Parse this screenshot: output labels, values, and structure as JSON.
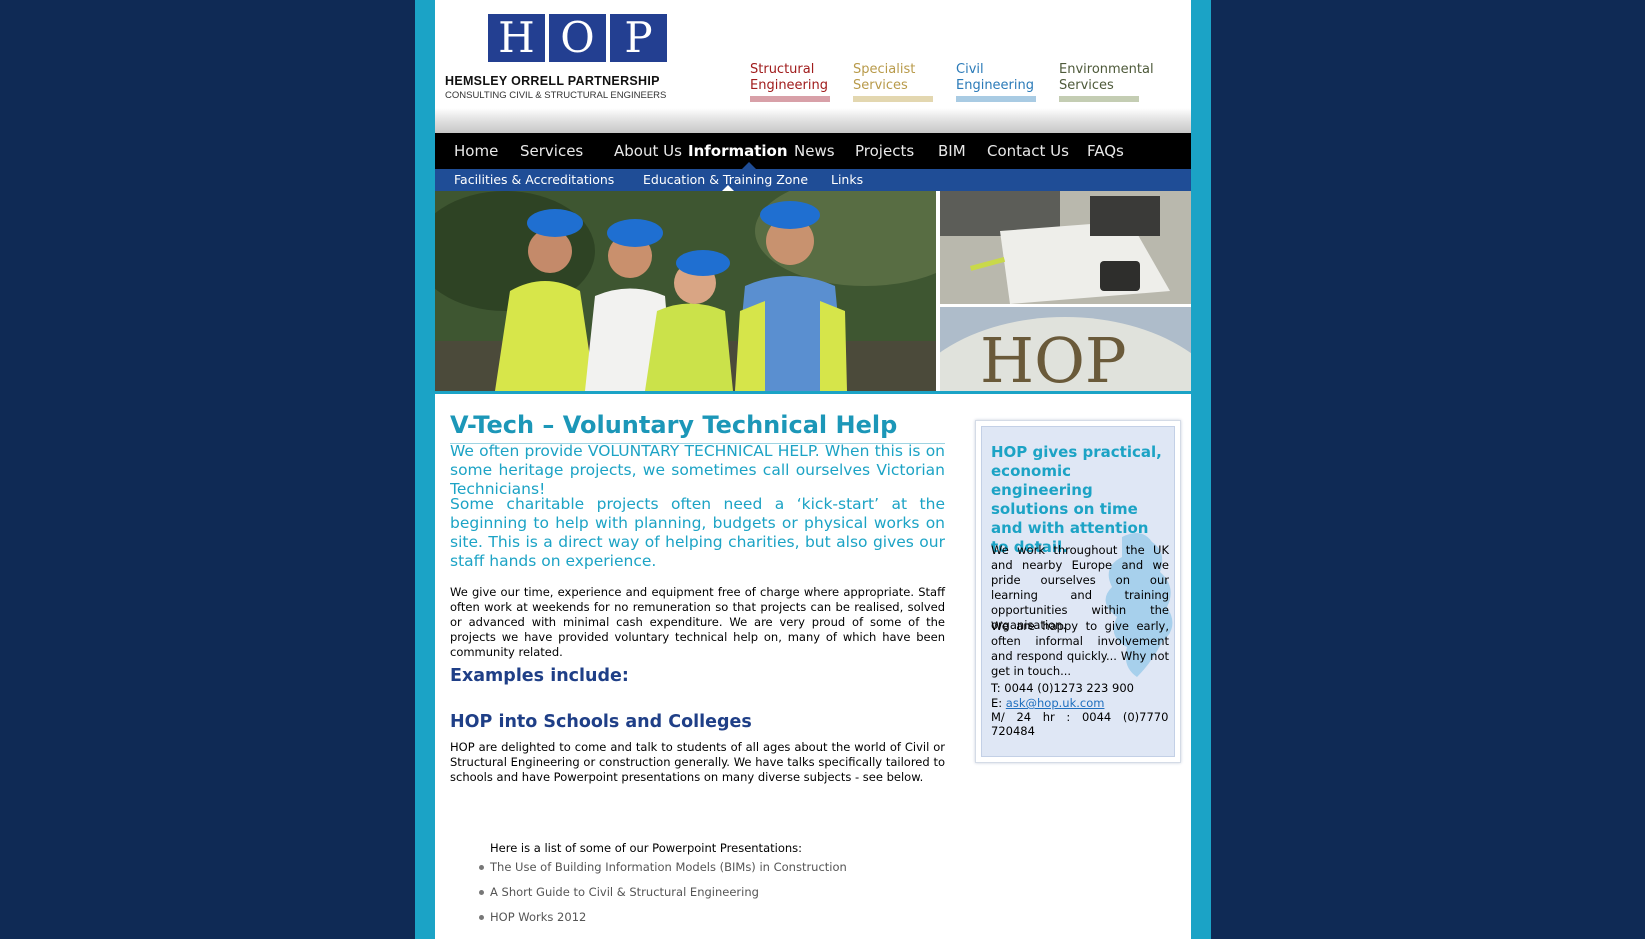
{
  "header": {
    "logo_letters": [
      "H",
      "O",
      "P"
    ],
    "company_name": "HEMSLEY ORRELL PARTNERSHIP",
    "tagline": "CONSULTING CIVIL & STRUCTURAL ENGINEERS",
    "service_links": [
      {
        "line1": "Structural",
        "line2": "Engineering",
        "color": "#a01c1c",
        "bar_color": "#d8a0a8"
      },
      {
        "line1": "Specialist",
        "line2": "Services",
        "color": "#b89a4a",
        "bar_color": "#e3d7b0"
      },
      {
        "line1": "Civil",
        "line2": "Engineering",
        "color": "#2a7ab8",
        "bar_color": "#a9cbe3"
      },
      {
        "line1": "Environmental",
        "line2": "Services",
        "color": "#4e5a3a",
        "bar_color": "#c4cdb3"
      }
    ]
  },
  "nav": {
    "items": [
      "Home",
      "Services",
      "About Us",
      "Information",
      "News",
      "Projects",
      "BIM",
      "Contact Us",
      "FAQs"
    ],
    "active": "Information"
  },
  "subnav": {
    "items": [
      "Facilities & Accreditations",
      "Education & Training Zone",
      "Links"
    ],
    "active": "Education & Training Zone"
  },
  "banner": {
    "sign_text": "HOP"
  },
  "main": {
    "title": "V-Tech – Voluntary Technical Help",
    "lead1": "We often provide VOLUNTARY TECHNICAL HELP. When this is on some heritage projects, we sometimes call ourselves Victorian Technicians!",
    "lead2": "Some charitable projects often need a ‘kick-start’ at the beginning to help with planning, budgets or physical works on site. This is a direct way of helping charities, but also gives our staff hands on experience.",
    "body1": "We give our time, experience and equipment free of charge where appropriate. Staff often work at weekends for no remuneration so that projects can be realised, solved or advanced with minimal cash expenditure. We are very proud of some of the projects we have provided voluntary technical help on, many of which have been community related.",
    "examples_heading": "Examples include:",
    "schools_heading": "HOP into Schools and Colleges",
    "schools_text": "HOP are delighted to come and talk to students of all ages about the world of Civil or Structural Engineering or construction generally. We have talks specifically tailored to schools and have Powerpoint presentations on many diverse subjects - see below.",
    "presentations_intro": "Here is a list of some of our Powerpoint Presentations:",
    "presentations": [
      "The Use of Building Information Models (BIMs) in Construction",
      "A Short Guide to Civil & Structural Engineering",
      "HOP Works 2012"
    ]
  },
  "sidebar": {
    "headline": "HOP gives practical, economic engineering solutions on time and with attention to detail.",
    "para1": "We work throughout the UK and nearby Europe and we pride ourselves on our learning and training opportunities within the organisation.",
    "para2": "We are happy to give early, often informal involvement and respond quickly... Why not get in touch...",
    "phone": "T: 0044 (0)1273 223 900",
    "email_label": "E: ",
    "email": "ask@hop.uk.com",
    "mobile_line1": "M/ 24 hr : 0044 (0)7770",
    "mobile_line2": "720484"
  }
}
